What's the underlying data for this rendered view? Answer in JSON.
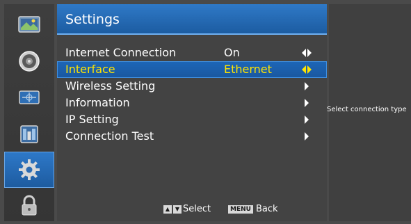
{
  "rail": {
    "items": [
      {
        "icon": "picture-icon",
        "active": false
      },
      {
        "icon": "sound-speaker-icon",
        "active": false
      },
      {
        "icon": "channel-antenna-icon",
        "active": false
      },
      {
        "icon": "time-calendar-icon",
        "active": false
      },
      {
        "icon": "gear-icon",
        "active": true
      },
      {
        "icon": "lock-icon",
        "active": false
      }
    ]
  },
  "panel": {
    "title": "Settings",
    "menu": [
      {
        "label": "Internet Connection",
        "value": "On",
        "arrow": "left-right"
      },
      {
        "label": "Interface",
        "value": "Ethernet",
        "arrow": "left-right",
        "selected": true
      },
      {
        "label": "Wireless Setting",
        "value": "",
        "arrow": "right"
      },
      {
        "label": "Information",
        "value": "",
        "arrow": "right"
      },
      {
        "label": "IP Setting",
        "value": "",
        "arrow": "right"
      },
      {
        "label": "Connection Test",
        "value": "",
        "arrow": "right"
      }
    ],
    "footer": {
      "select_label": "Select",
      "menu_key": "MENU",
      "back_label": "Back"
    }
  },
  "help": {
    "text": "Select connection type"
  },
  "colors": {
    "background": "#4a4a4a",
    "header_blue": "#2f79c7",
    "selected_text": "#ffe400",
    "text": "#ffffff"
  }
}
